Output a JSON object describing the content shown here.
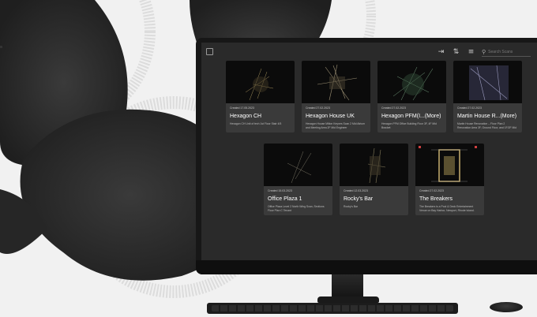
{
  "app": {
    "search_placeholder": "Search Scans",
    "icons": [
      "app-logo-icon",
      "export-icon",
      "sort-icon",
      "list-view-icon",
      "search-icon"
    ]
  },
  "cards": [
    {
      "title": "Hexagon CH",
      "date": "Created 17.05.2023",
      "desc": "Hexagon CH Unit of tech 1st Floor Stair 4/5",
      "tone": "#c8b070"
    },
    {
      "title": "Hexagon House UK",
      "date": "Created 27.02.2023",
      "desc": "Hexagon House Milton Keynes Scan 2 Mid Atrium and Meeting Area 2F Mid Engineer",
      "tone": "#a89a80"
    },
    {
      "title": "Hexagon PFM(I...(More)",
      "date": "Created 27.02.2023",
      "desc": "Hexagon PFM Office Building Floor 3F, 4F Mid Bracket",
      "tone": "#7fb08a"
    },
    {
      "title": "Martin House R...(More)",
      "date": "Created 27.02.2023",
      "desc": "Martin House Renovation – Floor Plan 2 Renovation Area 3F, Ground Floor, and 1F/2F Mid",
      "tone": "#9f9fc8"
    },
    {
      "title": "Office Plaza 1",
      "date": "Created 15.03.2023",
      "desc": "Office Plaza Level 2 North Wing Scan, Sections Floor Plan C Tenant",
      "tone": "#8a8470"
    },
    {
      "title": "Rocky's Bar",
      "date": "Created 12.03.2023",
      "desc": "Rocky's Bar",
      "tone": "#9a8f6a"
    },
    {
      "title": "The Breakers",
      "date": "Created 27.02.2023",
      "desc": "The Breakers is a Pool & Deck Entertainment Venue on Bay Harbor, Newport, Rhode Island. Scan Includes Outdoor, Interior, Kitchen",
      "tone": "#c8b070"
    }
  ]
}
